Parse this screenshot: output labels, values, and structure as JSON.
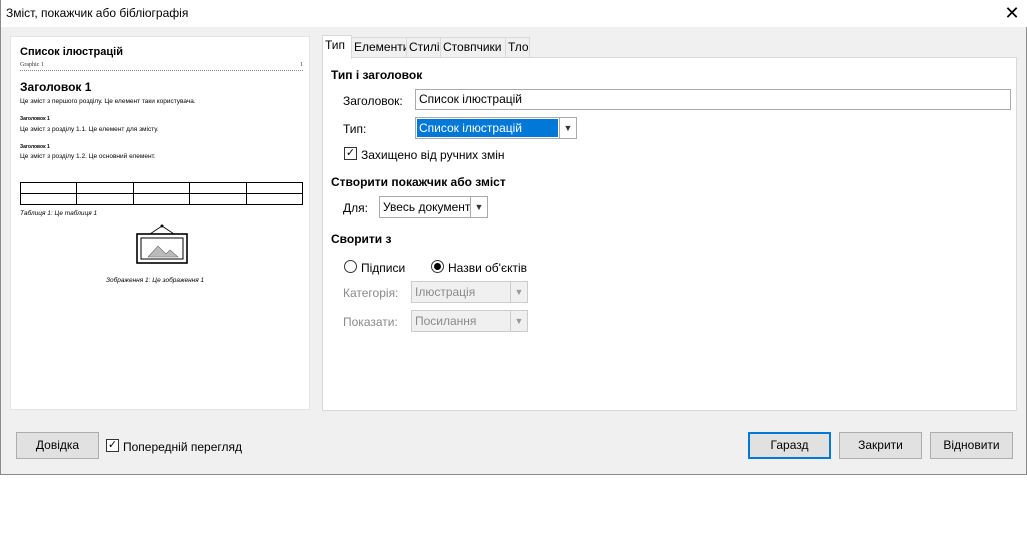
{
  "window": {
    "title": "Зміст, покажчик або бібліографія",
    "close_glyph": "✕"
  },
  "preview": {
    "title": "Список ілюстрацій",
    "entry_label": "Graphic 1",
    "entry_page": "1",
    "heading1": "Заголовок 1",
    "text1": "Це зміст з першого розділу. Це елемент таки користувача.",
    "heading11": "Заголовок 1",
    "text11": "Це зміст з розділу 1.1. Це елемент для змісту.",
    "heading12": "Заголовок 1",
    "text12": "Це зміст з розділу 1.2. Це основний елемент.",
    "table_caption": "Таблиця 1: Це таблиця 1",
    "image_caption": "Зображення 1: Це зображення 1"
  },
  "tabs": [
    "Тип",
    "Елементи",
    "Стилі",
    "Стовпчики",
    "Тло"
  ],
  "type_section": {
    "heading": "Тип і заголовок",
    "title_label": "Заголовок:",
    "title_value": "Список ілюстрацій",
    "type_label": "Тип:",
    "type_value": "Список ілюстрацій",
    "protect_label": "Захищено від ручних змін",
    "protect_checked": true
  },
  "create_section": {
    "heading": "Створити покажчик або зміст",
    "for_label": "Для:",
    "for_value": "Увесь документ"
  },
  "from_section": {
    "heading": "Сворити з",
    "captions_label": "Підписи",
    "object_names_label": "Назви об'єктів",
    "selected": "object_names",
    "category_label": "Категорія:",
    "category_value": "Ілюстрація",
    "display_label": "Показати:",
    "display_value": "Посилання"
  },
  "footer": {
    "help": "Довідка",
    "preview_label": "Попередній перегляд",
    "preview_checked": true,
    "ok": "Гаразд",
    "close": "Закрити",
    "reset": "Відновити"
  },
  "colors": {
    "selection": "#0078d7",
    "dialog_bg": "#f0f0f0"
  }
}
